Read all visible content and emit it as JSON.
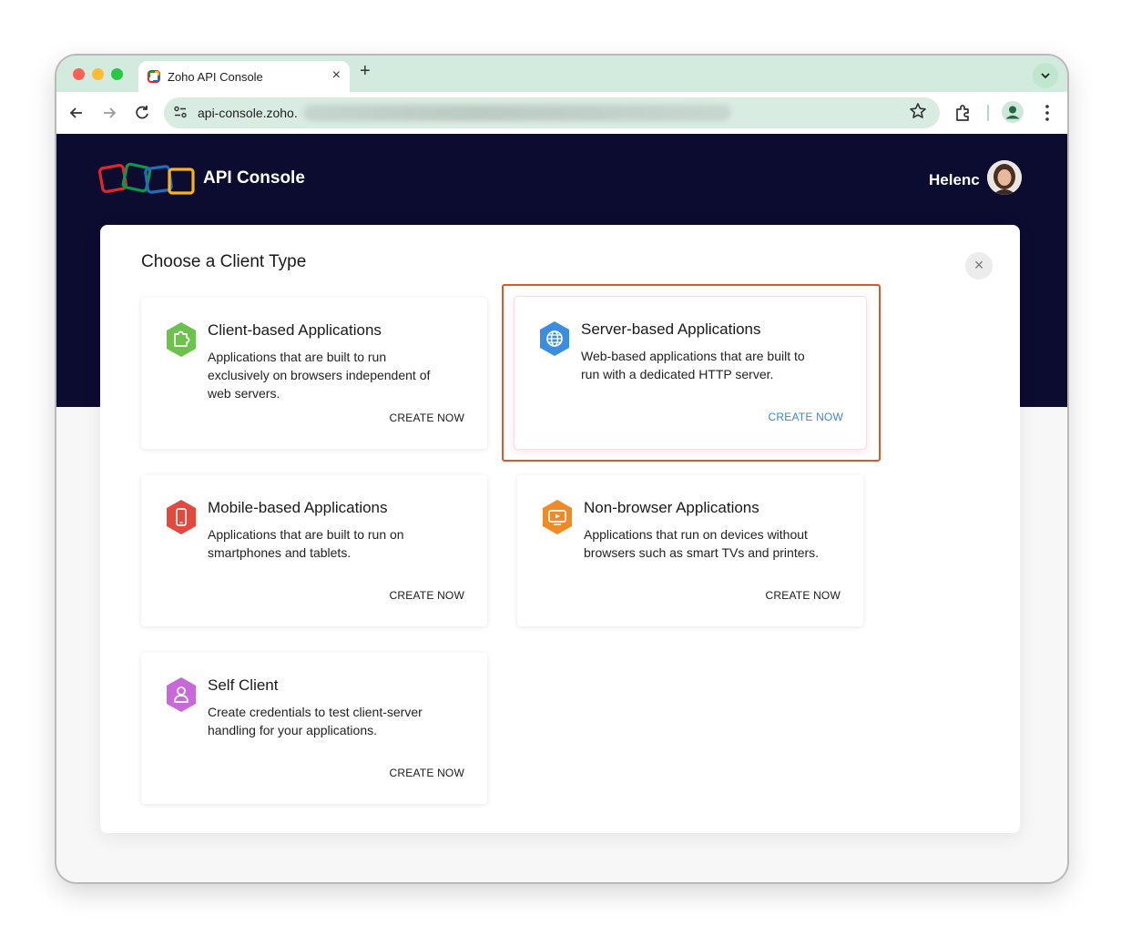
{
  "browser": {
    "tab_title": "Zoho API Console",
    "tab_close": "×",
    "new_tab": "+",
    "tab_search": "⌄",
    "url_visible": "api-console.zoho.",
    "colors": {
      "tabstrip": "#d3eadf",
      "omnibox": "#d9ece2"
    }
  },
  "header": {
    "app_title": "API Console",
    "user_name": "Helenc",
    "colors": {
      "band": "#0c0b30"
    }
  },
  "modal": {
    "title": "Choose a Client Type",
    "close_glyph": "×",
    "cards": [
      {
        "title": "Client-based Applications",
        "description": "Applications that are built to run exclusively on browsers independent of web servers.",
        "cta": "CREATE NOW",
        "icon": "puzzle-icon",
        "color": "#6cc24a"
      },
      {
        "title": "Server-based Applications",
        "description": "Web-based applications that are built to run with a dedicated HTTP server.",
        "cta": "CREATE NOW",
        "icon": "globe-icon",
        "color": "#3b8de0",
        "selected": true
      },
      {
        "title": "Mobile-based Applications",
        "description": "Applications that are built to run on smartphones and tablets.",
        "cta": "CREATE NOW",
        "icon": "smartphone-icon",
        "color": "#e5483d"
      },
      {
        "title": "Non-browser Applications",
        "description": "Applications that run on devices without browsers such as smart TVs and printers.",
        "cta": "CREATE NOW",
        "icon": "tv-icon",
        "color": "#f08a24"
      },
      {
        "title": "Self Client",
        "description": "Create credentials to test client-server handling for your applications.",
        "cta": "CREATE NOW",
        "icon": "user-icon",
        "color": "#c868d9"
      }
    ],
    "highlight_color": "#d9582d",
    "selected_cta_color": "#3d86d4"
  }
}
